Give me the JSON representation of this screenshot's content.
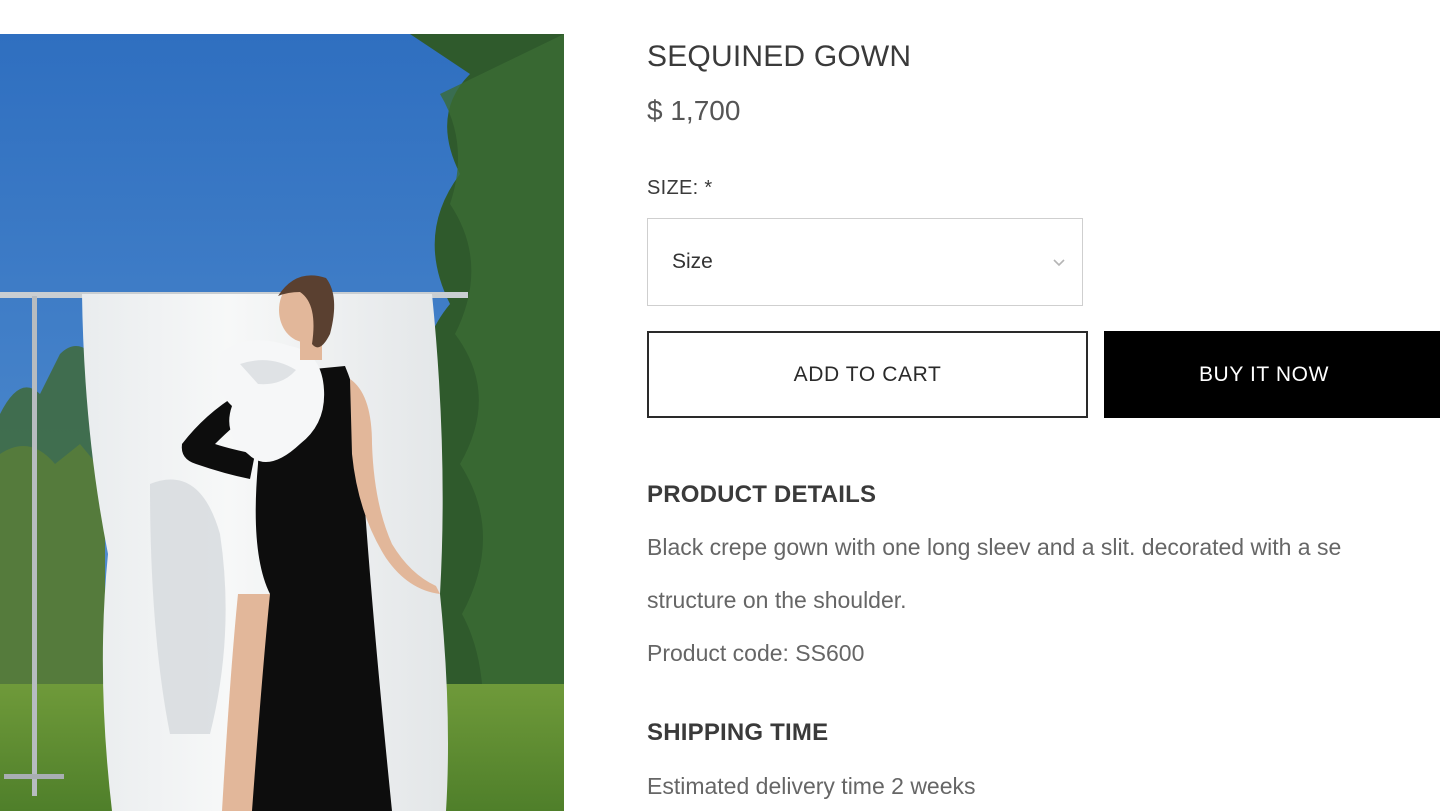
{
  "product": {
    "title": "SEQUINED GOWN",
    "price": "$ 1,700",
    "image_alt": "Model wearing black crepe gown with white ruffle shoulder"
  },
  "size": {
    "label": "SIZE: *",
    "selected": "Size"
  },
  "actions": {
    "add_to_cart": "ADD TO CART",
    "buy_now": "BUY IT NOW"
  },
  "details": {
    "heading": "PRODUCT DETAILS",
    "description_line_1": "Black crepe gown with one long sleev and a slit. decorated with a se",
    "description_line_2": "structure on the shoulder.",
    "product_code": "Product code: SS600"
  },
  "shipping": {
    "heading": "SHIPPING TIME",
    "estimate": "Estimated delivery time 2 weeks"
  },
  "colors": {
    "primary_button_bg": "#000000",
    "text": "#3a3a3a",
    "muted_text": "#666666",
    "border": "#cfcfcf"
  },
  "icons": {
    "size_dropdown": "chevron-down-icon"
  }
}
